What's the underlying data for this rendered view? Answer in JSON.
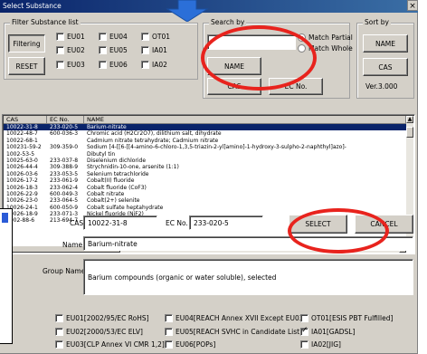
{
  "window": {
    "title": "Select Substance",
    "close_label": "×"
  },
  "filter_group": {
    "title": "Filter Substance list",
    "filtering_label": "Filtering",
    "reset_label": "RESET",
    "checks": [
      {
        "label": "EU01",
        "checked": false
      },
      {
        "label": "EU04",
        "checked": false
      },
      {
        "label": "OT01",
        "checked": false
      },
      {
        "label": "EU02",
        "checked": false
      },
      {
        "label": "EU05",
        "checked": false
      },
      {
        "label": "IA01",
        "checked": false
      },
      {
        "label": "EU03",
        "checked": false
      },
      {
        "label": "EU06",
        "checked": false
      },
      {
        "label": "IA02",
        "checked": false
      }
    ]
  },
  "search_group": {
    "title": "Search by",
    "input_value": "",
    "radio_partial": "Match Partial",
    "radio_whole": "Match Whole",
    "name_button": "NAME",
    "cas_button": "CAS",
    "ecno_button": "EC No."
  },
  "sort_group": {
    "title": "Sort by",
    "name_button": "NAME",
    "cas_button": "CAS",
    "version": "Ver.3.000"
  },
  "list": {
    "columns": [
      "CAS",
      "EC No.",
      "NAME"
    ],
    "rows": [
      {
        "cas": "10022-31-8",
        "ec": "233-020-5",
        "name": "Barium-nitrate",
        "selected": true
      },
      {
        "cas": "10022-48-7",
        "ec": "600-036-3",
        "name": "Chromic acid (H2Cr2O7), dilithium salt, dihydrate",
        "selected": false
      },
      {
        "cas": "10022-68-1",
        "ec": "",
        "name": "Cadmium nitrate tetrahydrate; Cadmium nitrate",
        "selected": false
      },
      {
        "cas": "100231-59-2",
        "ec": "309-359-0",
        "name": "Sodium [4-[[6-[[4-amino-6-chloro-1,3,5-triazin-2-yl]amino]-1-hydroxy-3-sulpho-2-naphthyl]azo]-",
        "selected": false
      },
      {
        "cas": "1002-53-5",
        "ec": "",
        "name": "Dibutyl tin",
        "selected": false
      },
      {
        "cas": "10025-63-0",
        "ec": "233-037-8",
        "name": "Diselenium dichloride",
        "selected": false
      },
      {
        "cas": "10026-44-4",
        "ec": "309-388-9",
        "name": "Strychnidin-10-one, arsenite (1:1)",
        "selected": false
      },
      {
        "cas": "10026-03-6",
        "ec": "233-053-5",
        "name": "Selenium tetrachloride",
        "selected": false
      },
      {
        "cas": "10026-17-2",
        "ec": "233-061-9",
        "name": "Cobalt(II) fluoride",
        "selected": false
      },
      {
        "cas": "10026-18-3",
        "ec": "233-062-4",
        "name": "Cobalt fluoride (CoF3)",
        "selected": false
      },
      {
        "cas": "10026-22-9",
        "ec": "600-049-3",
        "name": "Cobalt nitrate",
        "selected": false
      },
      {
        "cas": "10026-23-0",
        "ec": "233-064-5",
        "name": "Cobalt(2+) selenite",
        "selected": false
      },
      {
        "cas": "10026-24-1",
        "ec": "600-050-9",
        "name": "Cobalt sulfate heptahydrate",
        "selected": false
      },
      {
        "cas": "10026-18-9",
        "ec": "233-071-3",
        "name": "Nickel fluoride (NiF2)",
        "selected": false
      },
      {
        "cas": "1002-88-6",
        "ec": "213-694-7",
        "name": "Cobalt distearate",
        "selected": false
      }
    ]
  },
  "detail": {
    "cas_label": "CAS",
    "cas_value": "10022-31-8",
    "ecno_label": "EC No.",
    "ecno_value": "233-020-5",
    "select_button": "SELECT",
    "cancel_button": "CANCEL",
    "name_label": "Name",
    "name_value": "Barium-nitrate",
    "group_label": "Group Name",
    "group_value": "Barium compounds (organic or water soluble), selected"
  },
  "regulations": [
    {
      "label": "EU01[2002/95/EC RoHS]",
      "checked": false
    },
    {
      "label": "EU04[REACH Annex XVII Except EU03]",
      "checked": false
    },
    {
      "label": "OT01[ESIS PBT Fulfilled]",
      "checked": false
    },
    {
      "label": "EU02[2000/53/EC ELV]",
      "checked": false
    },
    {
      "label": "EU05[REACH SVHC in Candidate List]",
      "checked": false
    },
    {
      "label": "IA01[GADSL]",
      "checked": true
    },
    {
      "label": "EU03[CLP Annex VI CMR 1,2]",
      "checked": false
    },
    {
      "label": "EU06[POPs]",
      "checked": false
    },
    {
      "label": "IA02[JIG]",
      "checked": false
    }
  ],
  "colors": {
    "annotation": "#e8231d",
    "arrow": "#2b6fd8",
    "selection": "#0a246a"
  }
}
